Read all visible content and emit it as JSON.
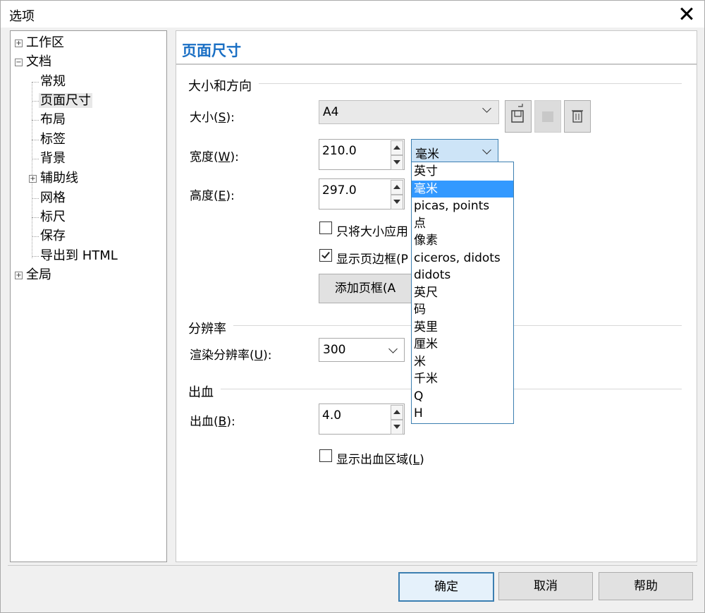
{
  "window": {
    "title": "选项"
  },
  "tree": [
    {
      "label": "工作区",
      "expander": "+"
    },
    {
      "label": "文档",
      "expander": "−"
    },
    {
      "label": "常规"
    },
    {
      "label": "页面尺寸",
      "selected": true
    },
    {
      "label": "布局"
    },
    {
      "label": "标签"
    },
    {
      "label": "背景"
    },
    {
      "label": "辅助线",
      "expander": "+"
    },
    {
      "label": "网格"
    },
    {
      "label": "标尺"
    },
    {
      "label": "保存"
    },
    {
      "label": "导出到 HTML"
    },
    {
      "label": "全局",
      "expander": "+"
    }
  ],
  "panel": {
    "title": "页面尺寸",
    "section_size": "大小和方向",
    "size_label": "大小(",
    "size_key": "S",
    "size_end": "):",
    "size_value": "A4",
    "width_label": "宽度(",
    "width_key": "W",
    "width_end": "):",
    "width_value": "210.0",
    "unit_value": "毫米",
    "height_label": "高度(",
    "height_key": "E",
    "height_end": "):",
    "height_value": "297.0",
    "only_size_label": "只将大小应用",
    "show_border_label": "显示页边框(P",
    "add_border_button": "添加页框(A",
    "section_resolution": "分辨率",
    "render_label": "渲染分辨率(",
    "render_key": "U",
    "render_end": "):",
    "render_value": "300",
    "section_bleed": "出血",
    "bleed_label": "出血(",
    "bleed_key": "B",
    "bleed_end": "):",
    "bleed_value": "4.0",
    "show_bleed_label": "显示出血区域(",
    "show_bleed_key": "L",
    "show_bleed_end": ")"
  },
  "units": [
    "英寸",
    "毫米",
    "picas, points",
    "点",
    "像素",
    "ciceros, didots",
    "didots",
    "英尺",
    "码",
    "英里",
    "厘米",
    "米",
    "千米",
    "Q",
    "H"
  ],
  "selected_unit_index": 1,
  "footer": {
    "ok": "确定",
    "cancel": "取消",
    "help": "帮助"
  }
}
